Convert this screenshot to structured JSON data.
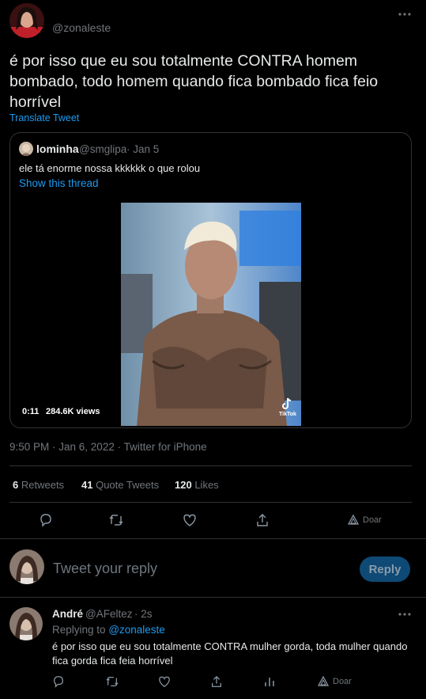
{
  "tweet": {
    "handle": "@zonaleste",
    "text": "é por isso que eu sou totalmente CONTRA homem bombado, todo homem quando fica bombado fica feio horrível",
    "translate_label": "Translate Tweet",
    "meta": "9:50 PM · Jan 6, 2022 · Twitter for iPhone"
  },
  "quote": {
    "name": "lominha",
    "handle": "@smglipa",
    "date": "· Jan 5",
    "text": "ele tá enorme nossa kkkkkk o que rolou",
    "show_thread": "Show this thread",
    "video": {
      "duration": "0:11",
      "views": "284.6K views",
      "watermark": "TikTok"
    }
  },
  "stats": {
    "retweets_count": "6",
    "retweets_label": "Retweets",
    "quote_count": "41",
    "quote_label": "Quote Tweets",
    "likes_count": "120",
    "likes_label": "Likes"
  },
  "actions": {
    "donate_label": "Doar"
  },
  "composer": {
    "placeholder": "Tweet your reply",
    "reply_label": "Reply"
  },
  "reply": {
    "name": "André",
    "handle": "@AFeltez",
    "time": "· 2s",
    "replying_prefix": "Replying to",
    "replying_to": "@zonaleste",
    "text": "é por isso que eu sou totalmente CONTRA mulher gorda, toda mulher quando fica gorda fica feia horrível",
    "donate_label": "Doar"
  },
  "colors": {
    "accent": "#1d9bf0",
    "background": "#000000",
    "border": "#2f3336",
    "muted": "#71767b"
  },
  "icons": [
    "more-icon",
    "reply-icon",
    "retweet-icon",
    "like-icon",
    "share-icon",
    "analytics-icon",
    "donate-icon",
    "tiktok-icon"
  ]
}
